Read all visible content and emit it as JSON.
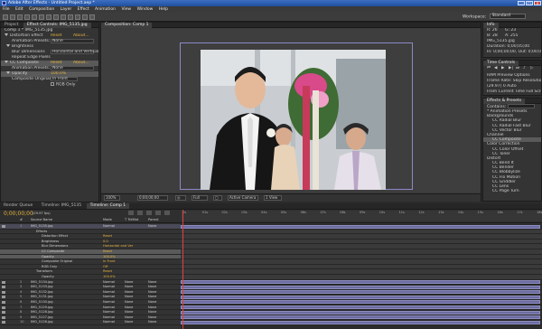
{
  "window": {
    "title": "Adobe After Effects - Untitled Project.aep *",
    "min": "_",
    "max": "□",
    "close": "×"
  },
  "menu": [
    "File",
    "Edit",
    "Composition",
    "Layer",
    "Effect",
    "Animation",
    "View",
    "Window",
    "Help"
  ],
  "workspace": {
    "label": "Workspace:",
    "value": "Standard"
  },
  "effect_controls": {
    "tabs": [
      "Project",
      "Effect Controls: IMG_5135.jpg"
    ],
    "header": "Comp 1 * IMG_5135.jpg",
    "rows": [
      {
        "label": "Distortion Effect",
        "value": "Reset",
        "extra": "About..."
      },
      {
        "label": "Animation Presets:",
        "value": "None"
      },
      {
        "label": "Brightness",
        "value": ""
      },
      {
        "label": "Blur Dimensions",
        "value": "Horizontal and Vertical"
      },
      {
        "label": "Repeat Edge Pixels",
        "value": ""
      },
      {
        "label": "CC Composite",
        "value": "Reset",
        "extra": "About..."
      },
      {
        "label": "Animation Presets:",
        "value": "None"
      },
      {
        "label": "Opacity",
        "value": "100.0%"
      },
      {
        "label": "Composite Original",
        "value": "In Front"
      },
      {
        "label": "",
        "value": "RGB Only"
      }
    ]
  },
  "composition": {
    "tab": "Composition: Comp 1",
    "zoom": "100%",
    "timecode": "0;00;00;00",
    "resolution": "Full",
    "camera": "Active Camera",
    "view": "1 View"
  },
  "info": {
    "tab": "Info",
    "lines": [
      "R: 26",
      "G: 23",
      "B: 28",
      "A: 255",
      "IMG_5135.jpg",
      "Duration: 0;00;05;00",
      "In: 0;00;00;00, Out: 0;00;04;29"
    ]
  },
  "preview": {
    "tab": "Time Controls",
    "lines": [
      "RAM Preview Options",
      "Frame Rate: Skip Resolution",
      "(29.97)  0  Auto",
      "From Current Time   Full Screen"
    ]
  },
  "effects": {
    "tab": "Effects & Presets",
    "search": "Contains:",
    "items": [
      "* Animation Presets",
      "  Backgrounds",
      "  CC Radial Blur",
      "  CC Radial Fast Blur",
      "  CC Vector Blur",
      "  Channel",
      "  CC Composite",
      "  Color Correction",
      "  CC Color Offset",
      "  CC Toner",
      "  Distort",
      "  CC Bend It",
      "  CC Bender",
      "  CC Blobbylize",
      "  CC Flo Motion",
      "  CC Griddler",
      "  CC Lens",
      "  CC Page Turn"
    ]
  },
  "timeline": {
    "tabs": [
      "Render Queue",
      "Timeline: IMG_5135",
      "Timeline: Comp 1"
    ],
    "timecode": "0;00;00;00",
    "fps": "(29.97 fps)",
    "columns": [
      "#",
      "Source Name",
      "Mode",
      "T TrkMat",
      "Parent"
    ],
    "ticks": [
      "0s",
      "01s",
      "02s",
      "03s",
      "04s",
      "05s",
      "06s",
      "07s",
      "08s",
      "09s",
      "10s",
      "11s",
      "12s",
      "13s",
      "14s",
      "15s",
      "16s",
      "17s",
      "18s"
    ],
    "layers": [
      {
        "n": "1",
        "name": "IMG_5135.jpg",
        "mode": "Normal",
        "trk": "",
        "parent": "None",
        "sel": true
      },
      {
        "n": "",
        "name": "Effects",
        "mode": "",
        "trk": "",
        "parent": ""
      },
      {
        "n": "",
        "name": "Distortion Effect",
        "mode": "Reset",
        "trk": "",
        "parent": ""
      },
      {
        "n": "",
        "name": "Brightness",
        "mode": "0.0",
        "trk": "",
        "parent": ""
      },
      {
        "n": "",
        "name": "Blur Dimensions",
        "mode": "Horizontal and Ver",
        "trk": "",
        "parent": ""
      },
      {
        "n": "",
        "name": "CC Composite",
        "mode": "Reset",
        "trk": "",
        "parent": "",
        "hl": true
      },
      {
        "n": "",
        "name": "Opacity",
        "mode": "100.0%",
        "trk": "",
        "parent": "",
        "hl": true
      },
      {
        "n": "",
        "name": "Composite Original",
        "mode": "In Front",
        "trk": "",
        "parent": ""
      },
      {
        "n": "",
        "name": "RGB Only",
        "mode": "Off",
        "trk": "",
        "parent": ""
      },
      {
        "n": "",
        "name": "Transform",
        "mode": "Reset",
        "trk": "",
        "parent": ""
      },
      {
        "n": "",
        "name": "Opacity",
        "mode": "100.0%",
        "trk": "",
        "parent": ""
      },
      {
        "n": "2",
        "name": "IMG_5134.jpg",
        "mode": "Normal",
        "trk": "None",
        "parent": "None"
      },
      {
        "n": "3",
        "name": "IMG_5133.jpg",
        "mode": "Normal",
        "trk": "None",
        "parent": "None"
      },
      {
        "n": "4",
        "name": "IMG_5132.jpg",
        "mode": "Normal",
        "trk": "None",
        "parent": "None"
      },
      {
        "n": "5",
        "name": "IMG_5131.jpg",
        "mode": "Normal",
        "trk": "None",
        "parent": "None"
      },
      {
        "n": "6",
        "name": "IMG_5130.jpg",
        "mode": "Normal",
        "trk": "None",
        "parent": "None"
      },
      {
        "n": "7",
        "name": "IMG_5129.jpg",
        "mode": "Normal",
        "trk": "None",
        "parent": "None"
      },
      {
        "n": "8",
        "name": "IMG_5128.jpg",
        "mode": "Normal",
        "trk": "None",
        "parent": "None"
      },
      {
        "n": "9",
        "name": "IMG_5127.jpg",
        "mode": "Normal",
        "trk": "None",
        "parent": "None"
      },
      {
        "n": "10",
        "name": "IMG_5126.jpg",
        "mode": "Normal",
        "trk": "None",
        "parent": "None"
      }
    ]
  },
  "colors": {
    "accent": "#e3b23c",
    "titlebar": "#2c5eb3",
    "layer_bar": "#6c6ca0",
    "playhead": "#e04040"
  }
}
